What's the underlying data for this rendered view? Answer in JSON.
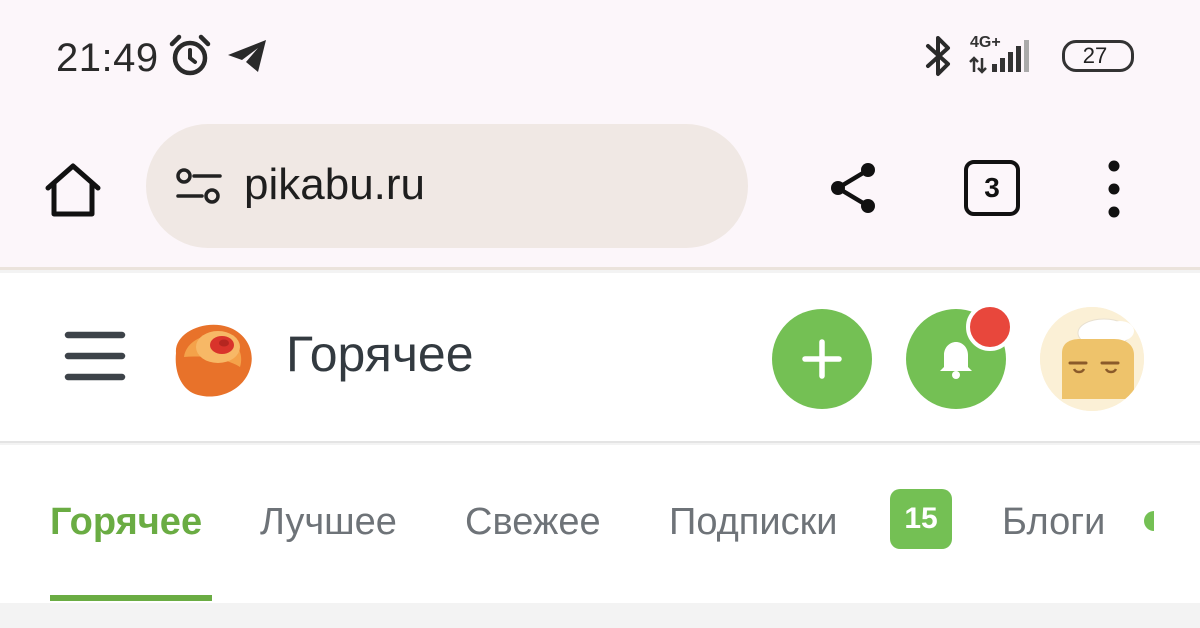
{
  "status_bar": {
    "time": "21:49",
    "network": "4G+",
    "battery": "27",
    "icons": [
      "alarm-icon",
      "telegram-icon",
      "bluetooth-icon",
      "signal-icon",
      "battery-icon"
    ]
  },
  "browser": {
    "url": "pikabu.ru",
    "tab_count": "3",
    "icons": [
      "home-icon",
      "site-settings-icon",
      "share-icon",
      "more-vert-icon"
    ]
  },
  "header": {
    "title": "Горячее",
    "icons": [
      "menu-icon",
      "pikabu-logo",
      "plus-icon",
      "bell-icon",
      "avatar"
    ]
  },
  "tabs": [
    {
      "label": "Горячее",
      "active": true
    },
    {
      "label": "Лучшее",
      "active": false
    },
    {
      "label": "Свежее",
      "active": false
    },
    {
      "label": "Подписки",
      "active": false,
      "badge": "15"
    },
    {
      "label": "Блоги",
      "active": false
    }
  ],
  "colors": {
    "accent_green": "#74c054",
    "active_tab": "#6aac43",
    "notification": "#e8473c",
    "chrome_bg": "#fcf6fa",
    "urlbar_bg": "#f0e8e4"
  }
}
